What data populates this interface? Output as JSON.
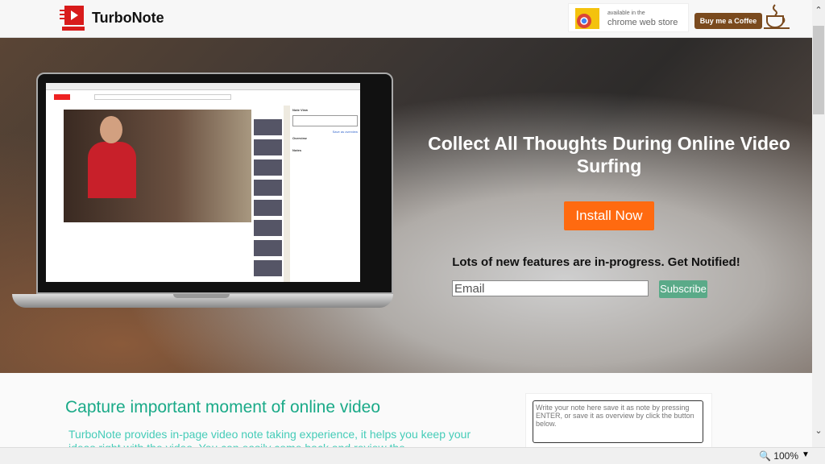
{
  "header": {
    "brand": "TurboNote",
    "logo_text": "TURBONOTE",
    "chrome_store": {
      "line1": "available in the",
      "line2": "chrome web store"
    },
    "coffee_label": "Buy me a Coffee"
  },
  "hero": {
    "title": "Collect All Thoughts During Online Video Surfing",
    "install_label": "Install Now",
    "notify_text": "Lots of new features are in-progress. Get Notified!",
    "email_placeholder": "Email",
    "subscribe_label": "Subscribe",
    "screenshot": {
      "note_view_title": "Note View",
      "save_overview": "Save as overview",
      "overview_label": "Overview",
      "notes_label": "Notes"
    }
  },
  "feature": {
    "heading": "Capture important moment of online video",
    "paragraph": "TurboNote provides in-page video note taking experience, it helps you keep your ideas right with the video. You can easily come back and review the",
    "note_placeholder": "Write your note here save it as note by pressing ENTER, or save it as overview by click the button below."
  },
  "status": {
    "zoom": "100%"
  },
  "colors": {
    "accent": "#ff6a10",
    "teal": "#1aaa88",
    "subscribe": "#5aaa88",
    "coffee": "#7a4a1e"
  }
}
